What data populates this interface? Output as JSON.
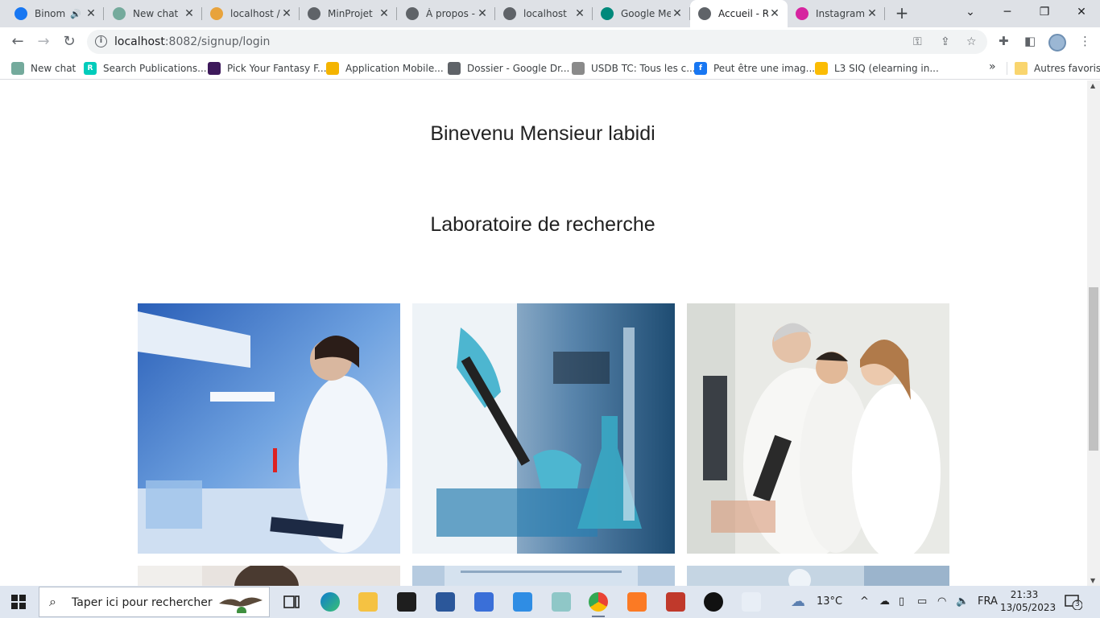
{
  "browser": {
    "tabs": [
      {
        "label": "Binom",
        "favicon": "facebook-icon",
        "color": "#1877f2",
        "audio": true,
        "active": false
      },
      {
        "label": "New chat",
        "favicon": "chatgpt-icon",
        "color": "#74aa9c",
        "audio": false,
        "active": false
      },
      {
        "label": "localhost /",
        "favicon": "phpmyadmin-icon",
        "color": "#e8a33c",
        "audio": false,
        "active": false
      },
      {
        "label": "MinProjet",
        "favicon": "globe-icon",
        "color": "#5f6368",
        "audio": false,
        "active": false
      },
      {
        "label": "À propos -",
        "favicon": "globe-icon",
        "color": "#5f6368",
        "audio": false,
        "active": false
      },
      {
        "label": "localhost",
        "favicon": "globe-icon",
        "color": "#5f6368",
        "audio": false,
        "active": false
      },
      {
        "label": "Google Me",
        "favicon": "google-meet-icon",
        "color": "#00897b",
        "audio": false,
        "active": false
      },
      {
        "label": "Accueil - R",
        "favicon": "globe-icon",
        "color": "#5f6368",
        "audio": false,
        "active": true
      },
      {
        "label": "Instagram",
        "favicon": "instagram-icon",
        "color": "#d6249f",
        "audio": false,
        "active": false
      }
    ],
    "url_host": "localhost",
    "url_rest": ":8082/signup/login",
    "bookmarks": [
      {
        "label": "New chat",
        "icon": "chatgpt-icon",
        "color": "#74aa9c",
        "glyph": ""
      },
      {
        "label": "Search Publications...",
        "icon": "researchgate-icon",
        "color": "#00ccbb",
        "glyph": "R"
      },
      {
        "label": "Pick Your Fantasy F...",
        "icon": "premier-league-icon",
        "color": "#3d195b",
        "glyph": ""
      },
      {
        "label": "Application Mobile...",
        "icon": "classroom-icon",
        "color": "#f4b400",
        "glyph": ""
      },
      {
        "label": "Dossier - Google Dr...",
        "icon": "globe-icon",
        "color": "#5f6368",
        "glyph": ""
      },
      {
        "label": "USDB TC: Tous les c...",
        "icon": "document-icon",
        "color": "#8a8a8a",
        "glyph": ""
      },
      {
        "label": "Peut être une imag...",
        "icon": "facebook-icon",
        "color": "#1877f2",
        "glyph": "f"
      },
      {
        "label": "L3 SIQ (elearning in...",
        "icon": "google-drive-icon",
        "color": "#fbbc04",
        "glyph": ""
      }
    ],
    "bookmarks_more": "»",
    "other_bookmarks": "Autres favoris"
  },
  "page": {
    "welcome": "Binevenu Mensieur labidi",
    "section_title": "Laboratoire de recherche"
  },
  "taskbar": {
    "search_placeholder": "Taper ici pour rechercher",
    "weather": "13°C",
    "language": "FRA",
    "time": "21:33",
    "date": "13/05/2023",
    "notifications": "3"
  }
}
